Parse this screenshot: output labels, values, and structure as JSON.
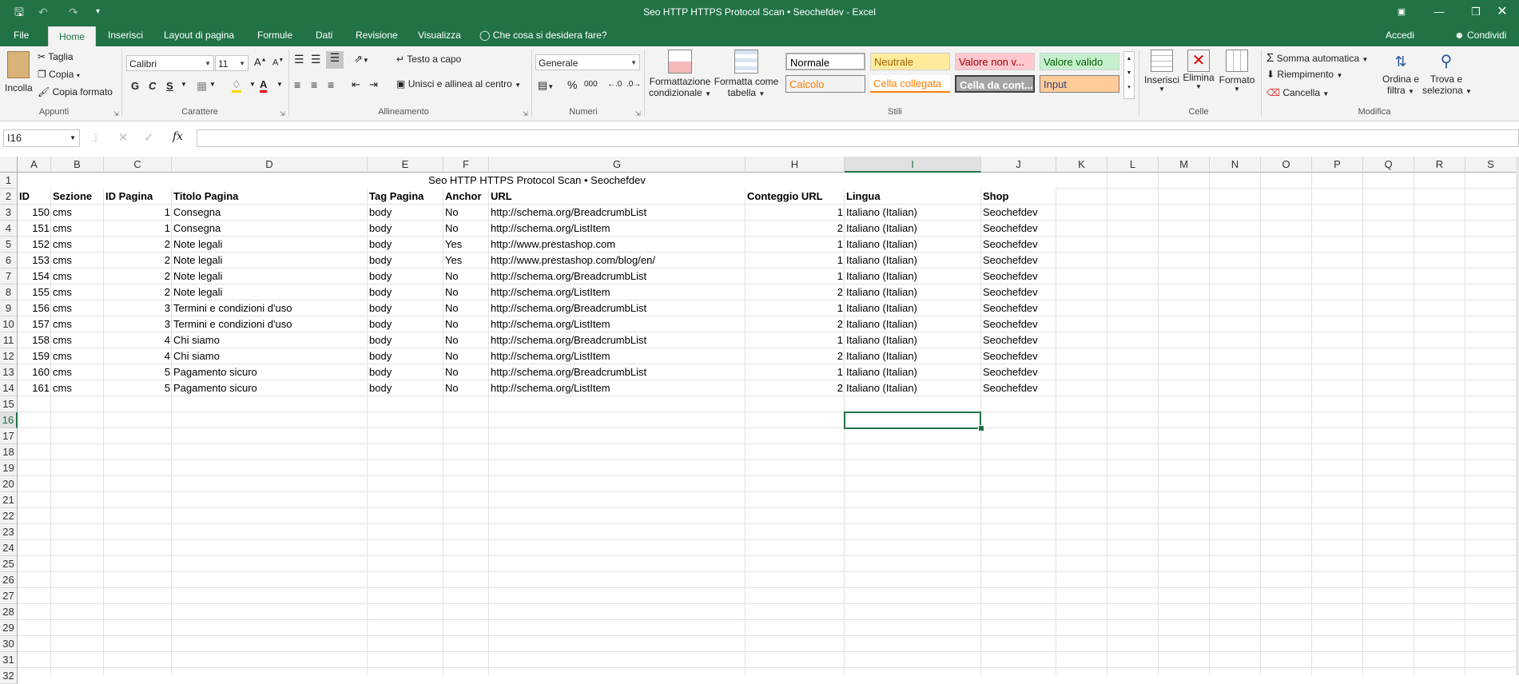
{
  "window": {
    "title": "Seo HTTP HTTPS Protocol Scan • Seochefdev - Excel",
    "save_icon": "save-icon",
    "undo_icon": "undo-icon",
    "redo_icon": "redo-icon",
    "customize_icon": "customize-qat-icon",
    "ribbon_display_icon": "ribbon-display-icon",
    "minimize_icon": "minimize-icon",
    "restore_icon": "restore-icon",
    "close_icon": "close-icon",
    "accent_color": "#217346"
  },
  "tabs": [
    "File",
    "Home",
    "Inserisci",
    "Layout di pagina",
    "Formule",
    "Dati",
    "Revisione",
    "Visualizza"
  ],
  "tell_me": "Che cosa si desidera fare?",
  "account": {
    "signin": "Accedi",
    "share": "Condividi"
  },
  "ribbon": {
    "clipboard": {
      "paste": "Incolla",
      "cut": "Taglia",
      "copy": "Copia",
      "format_painter": "Copia formato",
      "label": "Appunti"
    },
    "font": {
      "name": "Calibri",
      "size": "11",
      "bold": "G",
      "italic": "C",
      "underline": "S",
      "label": "Carattere"
    },
    "alignment": {
      "wrap": "Testo a capo",
      "merge": "Unisci e allinea al centro",
      "label": "Allineamento"
    },
    "number": {
      "format": "Generale",
      "percent": "%",
      "thousands": "000",
      "label": "Numeri"
    },
    "styles": {
      "conditional": [
        "Formattazione",
        "condizionale"
      ],
      "format_table": [
        "Formatta come",
        "tabella"
      ],
      "cells": [
        "Normale",
        "Neutrale",
        "Valore non v...",
        "Valore valido",
        "Calcolo",
        "Cella collegata",
        "Cella da cont...",
        "Input"
      ],
      "label": "Stili"
    },
    "cells": {
      "insert": "Inserisci",
      "delete": "Elimina",
      "format": "Formato",
      "label": "Celle"
    },
    "editing": {
      "autosum": "Somma automatica",
      "fill": "Riempimento",
      "clear": "Cancella",
      "sort": [
        "Ordina e",
        "filtra"
      ],
      "find": [
        "Trova e",
        "seleziona"
      ],
      "label": "Modifica"
    }
  },
  "formula_bar": {
    "name_box": "I16",
    "fx": "fx",
    "value": ""
  },
  "columns": [
    "A",
    "B",
    "C",
    "D",
    "E",
    "F",
    "G",
    "H",
    "I",
    "J",
    "K",
    "L",
    "M",
    "N",
    "O",
    "P",
    "Q",
    "R",
    "S"
  ],
  "row_numbers": [
    "1",
    "2",
    "3",
    "4",
    "5",
    "6",
    "7",
    "8",
    "9",
    "10",
    "11",
    "12",
    "13",
    "14",
    "15",
    "16",
    "17",
    "18",
    "19",
    "20",
    "21",
    "22",
    "23",
    "24",
    "25",
    "26",
    "27",
    "28",
    "29",
    "30",
    "31",
    "32"
  ],
  "sheet": {
    "title": "Seo HTTP HTTPS Protocol Scan • Seochefdev",
    "headers": [
      "ID",
      "Sezione",
      "ID Pagina",
      "Titolo Pagina",
      "Tag Pagina",
      "Anchor",
      "URL",
      "Conteggio URL",
      "Lingua",
      "Shop"
    ],
    "rows": [
      [
        "150",
        "cms",
        "1",
        "Consegna",
        "body",
        "No",
        "http://schema.org/BreadcrumbList",
        "1",
        "Italiano (Italian)",
        "Seochefdev"
      ],
      [
        "151",
        "cms",
        "1",
        "Consegna",
        "body",
        "No",
        "http://schema.org/ListItem",
        "2",
        "Italiano (Italian)",
        "Seochefdev"
      ],
      [
        "152",
        "cms",
        "2",
        "Note legali",
        "body",
        "Yes",
        "http://www.prestashop.com",
        "1",
        "Italiano (Italian)",
        "Seochefdev"
      ],
      [
        "153",
        "cms",
        "2",
        "Note legali",
        "body",
        "Yes",
        "http://www.prestashop.com/blog/en/",
        "1",
        "Italiano (Italian)",
        "Seochefdev"
      ],
      [
        "154",
        "cms",
        "2",
        "Note legali",
        "body",
        "No",
        "http://schema.org/BreadcrumbList",
        "1",
        "Italiano (Italian)",
        "Seochefdev"
      ],
      [
        "155",
        "cms",
        "2",
        "Note legali",
        "body",
        "No",
        "http://schema.org/ListItem",
        "2",
        "Italiano (Italian)",
        "Seochefdev"
      ],
      [
        "156",
        "cms",
        "3",
        "Termini e condizioni d'uso",
        "body",
        "No",
        "http://schema.org/BreadcrumbList",
        "1",
        "Italiano (Italian)",
        "Seochefdev"
      ],
      [
        "157",
        "cms",
        "3",
        "Termini e condizioni d'uso",
        "body",
        "No",
        "http://schema.org/ListItem",
        "2",
        "Italiano (Italian)",
        "Seochefdev"
      ],
      [
        "158",
        "cms",
        "4",
        "Chi siamo",
        "body",
        "No",
        "http://schema.org/BreadcrumbList",
        "1",
        "Italiano (Italian)",
        "Seochefdev"
      ],
      [
        "159",
        "cms",
        "4",
        "Chi siamo",
        "body",
        "No",
        "http://schema.org/ListItem",
        "2",
        "Italiano (Italian)",
        "Seochefdev"
      ],
      [
        "160",
        "cms",
        "5",
        "Pagamento sicuro",
        "body",
        "No",
        "http://schema.org/BreadcrumbList",
        "1",
        "Italiano (Italian)",
        "Seochefdev"
      ],
      [
        "161",
        "cms",
        "5",
        "Pagamento sicuro",
        "body",
        "No",
        "http://schema.org/ListItem",
        "2",
        "Italiano (Italian)",
        "Seochefdev"
      ]
    ]
  },
  "selection": {
    "cell": "I16"
  }
}
